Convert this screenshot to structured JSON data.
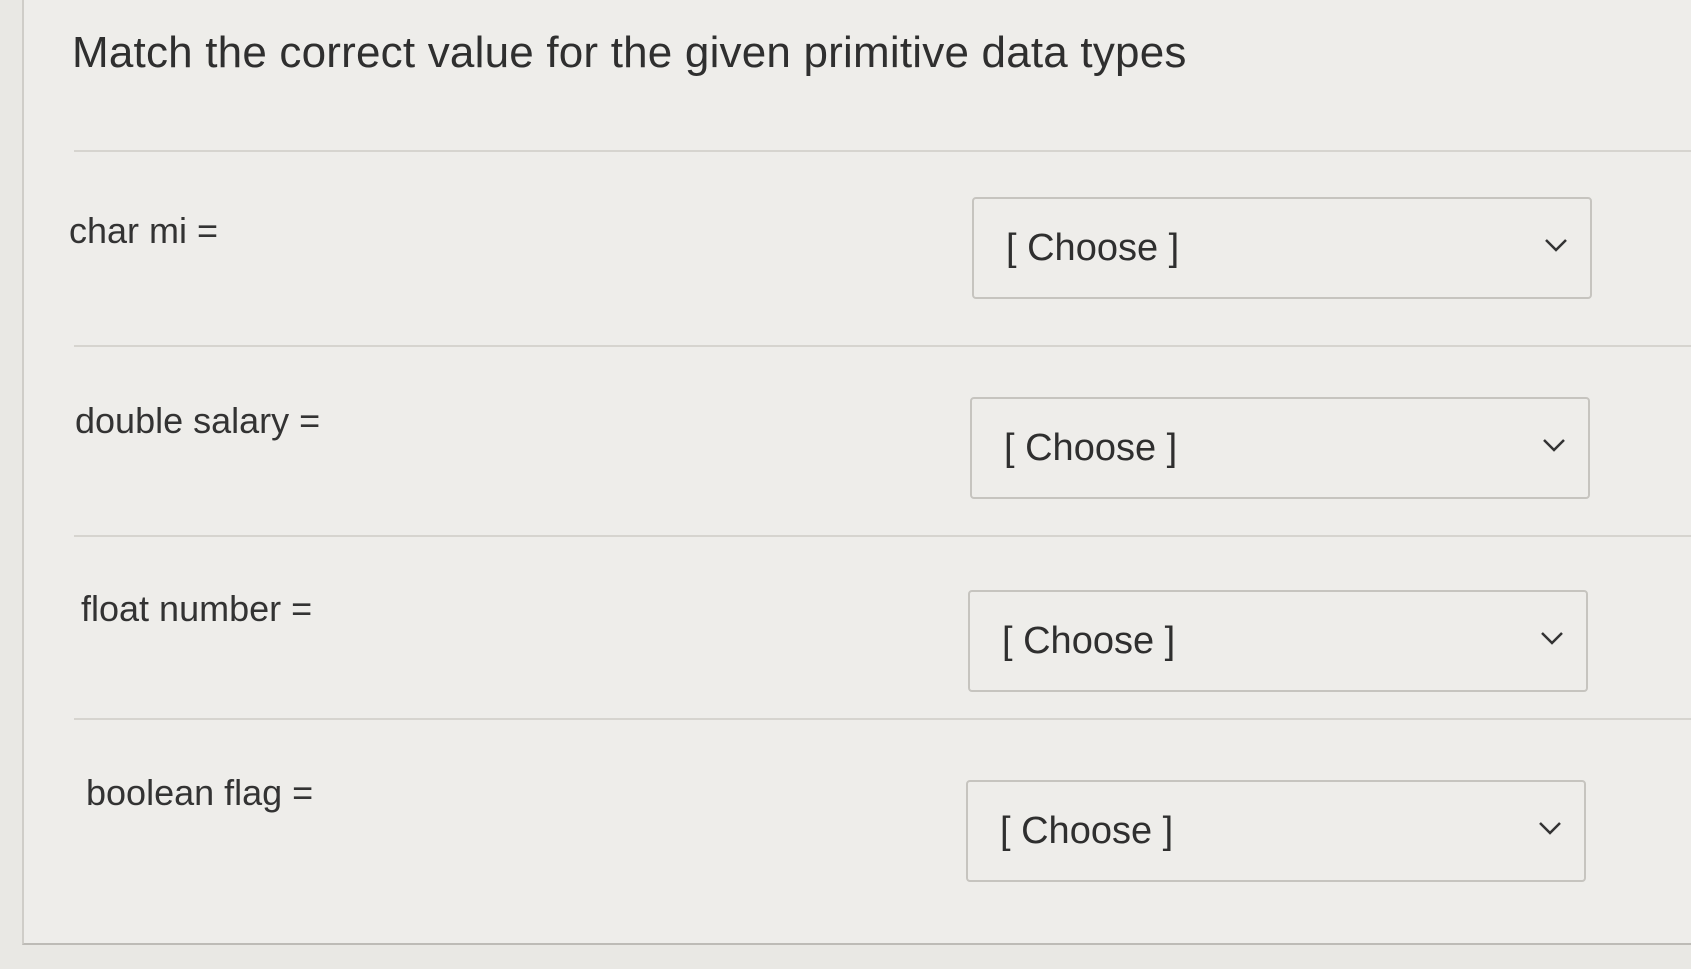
{
  "question": {
    "title": "Match the correct value for the given primitive data types"
  },
  "rows": [
    {
      "label": "char mi =",
      "select_value": "[ Choose ]"
    },
    {
      "label": "double salary =",
      "select_value": "[ Choose ]"
    },
    {
      "label": "float number =",
      "select_value": "[ Choose ]"
    },
    {
      "label": "boolean flag =",
      "select_value": "[ Choose ]"
    }
  ],
  "icons": {
    "dropdown": "chevron-down-icon"
  },
  "colors": {
    "background": "#eeedea",
    "text": "#2f2f2f",
    "border": "#c6c4bf"
  }
}
